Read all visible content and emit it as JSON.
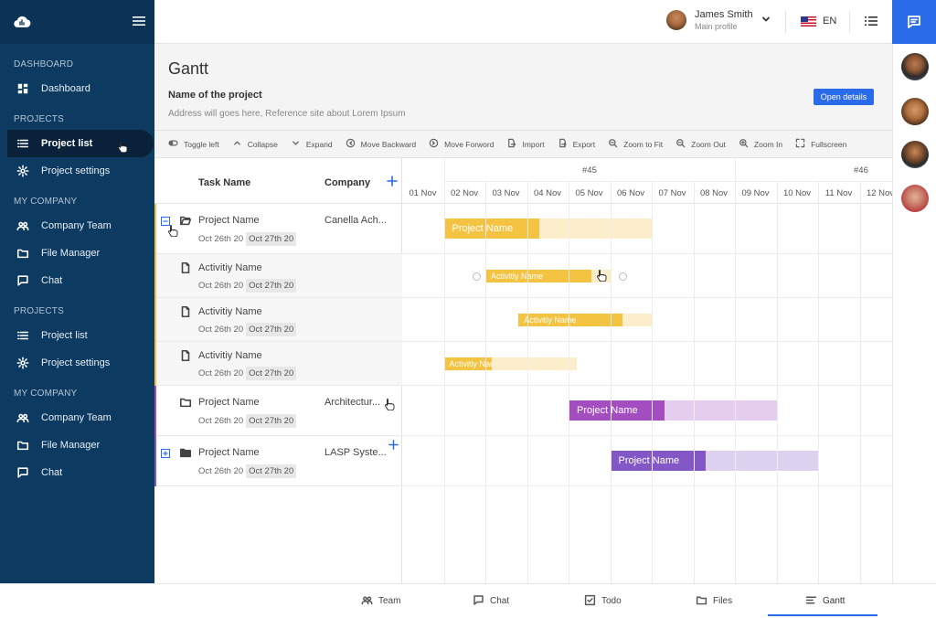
{
  "sidebar": {
    "sections": [
      {
        "title": "DASHBOARD",
        "items": [
          {
            "label": "Dashboard",
            "icon": "dashboard-icon"
          }
        ]
      },
      {
        "title": "PROJECTS",
        "items": [
          {
            "label": "Project list",
            "icon": "list-icon",
            "active": true
          },
          {
            "label": "Project settings",
            "icon": "gear-icon"
          }
        ]
      },
      {
        "title": "MY COMPANY",
        "items": [
          {
            "label": "Company Team",
            "icon": "team-icon"
          },
          {
            "label": "File Manager",
            "icon": "folder-icon"
          },
          {
            "label": "Chat",
            "icon": "chat-icon"
          }
        ]
      },
      {
        "title": "PROJECTS",
        "items": [
          {
            "label": "Project list",
            "icon": "list-icon"
          },
          {
            "label": "Project settings",
            "icon": "gear-icon"
          }
        ]
      },
      {
        "title": "MY COMPANY",
        "items": [
          {
            "label": "Company Team",
            "icon": "team-icon"
          },
          {
            "label": "File Manager",
            "icon": "folder-icon"
          },
          {
            "label": "Chat",
            "icon": "chat-icon"
          }
        ]
      }
    ]
  },
  "topbar": {
    "user_name": "James Smith",
    "user_sub": "Main profile",
    "language": "EN"
  },
  "header": {
    "title": "Gantt",
    "project_name": "Name of the project",
    "project_address": "Address will goes here, Reference site about Lorem Ipsum",
    "open_details": "Open details"
  },
  "toolbar": [
    {
      "label": "Toggle left",
      "icon": "toggle-icon"
    },
    {
      "label": "Collapse",
      "icon": "chevron-up-icon"
    },
    {
      "label": "Expand",
      "icon": "chevron-down-icon"
    },
    {
      "label": "Move Backward",
      "icon": "move-backward-icon"
    },
    {
      "label": "Move Forword",
      "icon": "move-forward-icon"
    },
    {
      "label": "Import",
      "icon": "import-icon"
    },
    {
      "label": "Export",
      "icon": "export-icon"
    },
    {
      "label": "Zoom to Fit",
      "icon": "zoom-fit-icon"
    },
    {
      "label": "Zoom Out",
      "icon": "zoom-out-icon"
    },
    {
      "label": "Zoom In",
      "icon": "zoom-in-icon"
    },
    {
      "label": "Fullscreen",
      "icon": "fullscreen-icon"
    }
  ],
  "grid": {
    "col_task": "Task Name",
    "col_company": "Company",
    "weeks": [
      "#45",
      "#46"
    ],
    "days": [
      "01 Nov",
      "02 Nov",
      "03 Nov",
      "04 Nov",
      "05 Nov",
      "06 Nov",
      "07 Nov",
      "08 Nov",
      "09 Nov",
      "10 Nov",
      "11 Nov",
      "12 Nov"
    ],
    "rows": [
      {
        "name": "Project Name",
        "company": "Canella Ach...",
        "start": "Oct 26th 20",
        "end": "Oct 27th 20",
        "type": "project",
        "icon": "folder-open-icon",
        "toggle": "collapse",
        "color": "#f5c342",
        "bar_label": "Project Name",
        "bar_start_day": 1,
        "bar_span_days": 5,
        "progress": 0.46
      },
      {
        "name": "Activitiy Name",
        "start": "Oct 26th 20",
        "end": "Oct 27th 20",
        "type": "activity",
        "icon": "file-icon",
        "color": "#f5c342",
        "bar_label": "Activitiy Name",
        "bar_start_day": 2,
        "bar_span_days": 3,
        "progress": 0.85
      },
      {
        "name": "Activitiy Name",
        "start": "Oct 26th 20",
        "end": "Oct 27th 20",
        "type": "activity",
        "icon": "file-icon",
        "color": "#f5c342",
        "bar_label": "Activitiy Name",
        "bar_start_day": 2.8,
        "bar_span_days": 3.2,
        "progress": 0.78
      },
      {
        "name": "Activitiy Name",
        "start": "Oct 26th 20",
        "end": "Oct 27th 20",
        "type": "activity",
        "icon": "file-icon",
        "color": "#f5c342",
        "bar_label": "Activitiy Name",
        "bar_start_day": 1,
        "bar_span_days": 3.2,
        "progress": 0.36
      },
      {
        "name": "Project Name",
        "company": "Architectur...",
        "start": "Oct 26th 20",
        "end": "Oct 27th 20",
        "type": "project",
        "icon": "folder-icon",
        "color": "#a34ec0",
        "bar_label": "Project Name",
        "bar_start_day": 4,
        "bar_span_days": 5,
        "progress": 0.46
      },
      {
        "name": "Project Name",
        "company": "LASP Syste...",
        "start": "Oct 26th 20",
        "end": "Oct 27th 20",
        "type": "project",
        "icon": "folder-solid-icon",
        "toggle": "expand",
        "color": "#8358c6",
        "bar_label": "Project Name",
        "bar_start_day": 5,
        "bar_span_days": 5,
        "progress": 0.46
      }
    ]
  },
  "bottom_tabs": [
    {
      "label": "Team",
      "icon": "team-icon"
    },
    {
      "label": "Chat",
      "icon": "chat-icon"
    },
    {
      "label": "Todo",
      "icon": "todo-icon"
    },
    {
      "label": "Files",
      "icon": "folder-icon"
    },
    {
      "label": "Gantt",
      "icon": "gantt-icon",
      "active": true
    }
  ],
  "colors": {
    "accent": "#2a6bea",
    "sidebar": "#0c3a60",
    "yellow": "#f5c342",
    "purple": "#a34ec0",
    "violet": "#8358c6"
  }
}
